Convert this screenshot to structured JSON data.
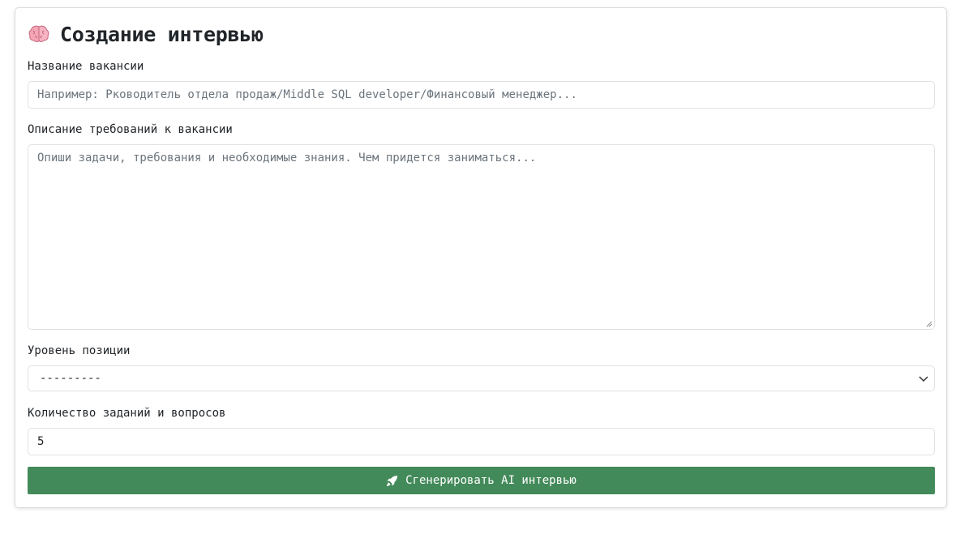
{
  "header": {
    "icon": "brain-icon",
    "title": "Создание интервью"
  },
  "form": {
    "vacancy_name": {
      "label": "Название вакансии",
      "value": "",
      "placeholder": "Например: Рководитель отдела продаж/Middle SQL developer/Финансовый менеджер..."
    },
    "description": {
      "label": "Описание требований к вакансии",
      "value": "",
      "placeholder": "Опиши задачи, требования и необходимые знания. Чем придется заниматься..."
    },
    "level": {
      "label": "Уровень позиции",
      "selected": "---------"
    },
    "count": {
      "label": "Количество заданий и вопросов",
      "value": "5"
    },
    "submit": {
      "icon": "rocket-icon",
      "label": "Сгенерировать AI интервью",
      "color": "#438a5a"
    }
  }
}
